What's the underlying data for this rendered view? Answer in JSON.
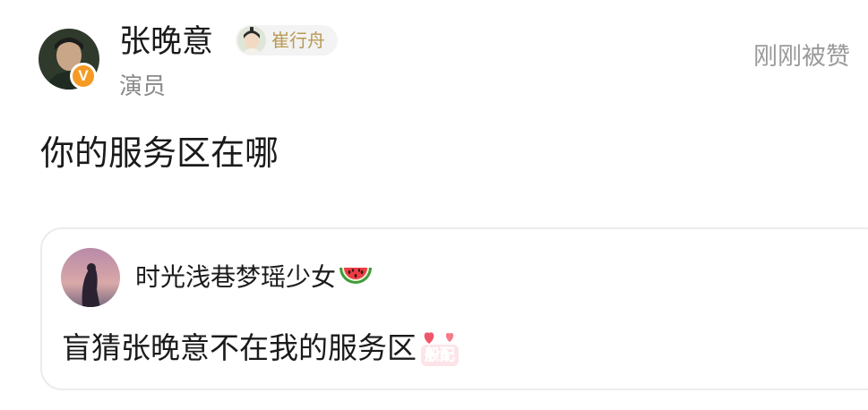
{
  "header": {
    "user_name": "张晚意",
    "user_title": "演员",
    "verified_badge": "V",
    "role_tag": "崔行舟",
    "like_status": "刚刚被赞"
  },
  "comment": {
    "text": "你的服务区在哪"
  },
  "quoted_reply": {
    "author": "时光浅巷梦瑶少女",
    "author_emoji": "watermelon-icon",
    "text": "盲猜张晚意不在我的服务区",
    "sticker_text": "般配",
    "sticker_icon": "hearts-sticker-icon"
  },
  "colors": {
    "name": "#1a1a1a",
    "secondary": "#8a8a8a",
    "like_status": "#9a9a9a",
    "role_tag_text": "#b89a55",
    "role_tag_bg": "#f3f3f3",
    "verified": "#f59a22",
    "card_border": "#ececec",
    "sticker": "#e8455c"
  }
}
